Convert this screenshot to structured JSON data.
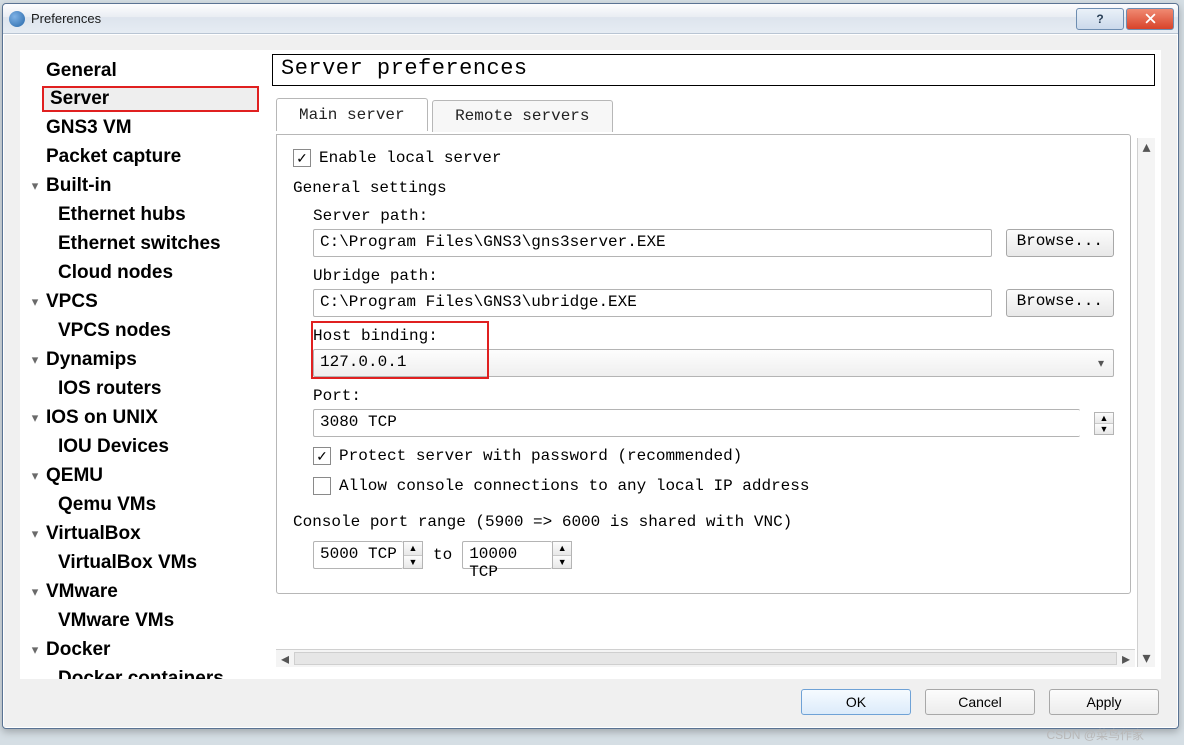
{
  "window": {
    "title": "Preferences",
    "help": "?",
    "close": ""
  },
  "tree": {
    "items": [
      {
        "label": "General",
        "expander": "",
        "cls": ""
      },
      {
        "label": "Server",
        "expander": "",
        "cls": "sel active"
      },
      {
        "label": "GNS3 VM",
        "expander": "",
        "cls": ""
      },
      {
        "label": "Packet capture",
        "expander": "",
        "cls": ""
      },
      {
        "label": "Built-in",
        "expander": "▾",
        "cls": ""
      },
      {
        "label": "Ethernet hubs",
        "expander": "",
        "cls": "child"
      },
      {
        "label": "Ethernet switches",
        "expander": "",
        "cls": "child"
      },
      {
        "label": "Cloud nodes",
        "expander": "",
        "cls": "child"
      },
      {
        "label": "VPCS",
        "expander": "▾",
        "cls": ""
      },
      {
        "label": "VPCS nodes",
        "expander": "",
        "cls": "child"
      },
      {
        "label": "Dynamips",
        "expander": "▾",
        "cls": ""
      },
      {
        "label": "IOS routers",
        "expander": "",
        "cls": "child"
      },
      {
        "label": "IOS on UNIX",
        "expander": "▾",
        "cls": ""
      },
      {
        "label": "IOU Devices",
        "expander": "",
        "cls": "child"
      },
      {
        "label": "QEMU",
        "expander": "▾",
        "cls": ""
      },
      {
        "label": "Qemu VMs",
        "expander": "",
        "cls": "child"
      },
      {
        "label": "VirtualBox",
        "expander": "▾",
        "cls": ""
      },
      {
        "label": "VirtualBox VMs",
        "expander": "",
        "cls": "child"
      },
      {
        "label": "VMware",
        "expander": "▾",
        "cls": ""
      },
      {
        "label": "VMware VMs",
        "expander": "",
        "cls": "child"
      },
      {
        "label": "Docker",
        "expander": "▾",
        "cls": ""
      },
      {
        "label": "Docker containers",
        "expander": "",
        "cls": "child"
      }
    ]
  },
  "page": {
    "title": "Server preferences",
    "tabs": {
      "main": "Main server",
      "remote": "Remote servers"
    },
    "enable_local": "Enable local server",
    "general_settings": "General settings",
    "server_path_label": "Server path:",
    "server_path_value": "C:\\Program Files\\GNS3\\gns3server.EXE",
    "ubridge_path_label": "Ubridge path:",
    "ubridge_path_value": "C:\\Program Files\\GNS3\\ubridge.EXE",
    "browse": "Browse...",
    "host_binding_label": "Host binding:",
    "host_binding_value": "127.0.0.1",
    "port_label": "Port:",
    "port_value": "3080 TCP",
    "protect_label": "Protect server with password (recommended)",
    "allow_console_label": "Allow console connections to any local IP address",
    "console_range_label": "Console port range (5900 => 6000 is shared with VNC)",
    "console_from": "5000 TCP",
    "to": "to",
    "console_to": "10000 TCP"
  },
  "buttons": {
    "ok": "OK",
    "cancel": "Cancel",
    "apply": "Apply"
  },
  "watermark": "CSDN @菜鸟作家"
}
